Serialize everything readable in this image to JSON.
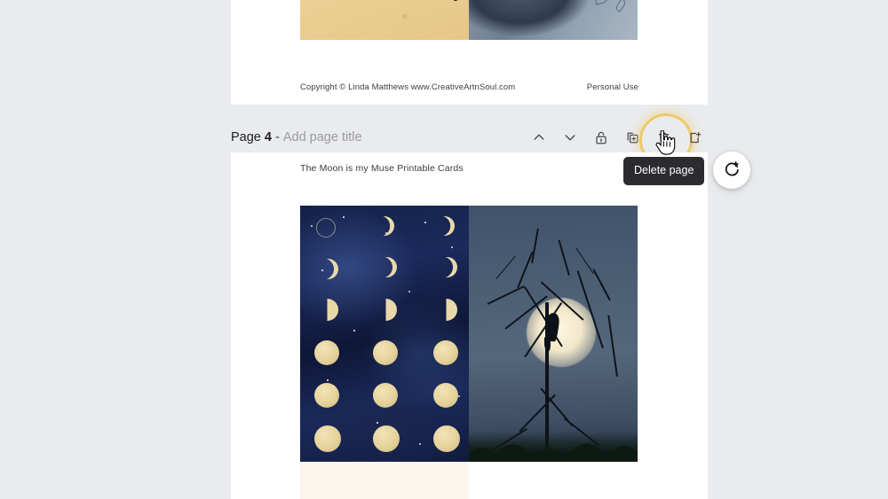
{
  "background_color": "#e9ebee",
  "previous_page": {
    "copyright_text": "Copyright © Linda Matthews www.CreativeArtnSoul.com",
    "license_text": "Personal Use",
    "artwork_left_name": "sand-texture-with-dots",
    "artwork_right_name": "blue-moon-crystal-photo"
  },
  "page_header": {
    "page_label": "Page",
    "page_number": "4",
    "separator": "-",
    "title_placeholder": "Add page title",
    "actions": [
      {
        "name": "move-page-up",
        "icon": "chevron-up-icon",
        "label": "Move page up"
      },
      {
        "name": "move-page-down",
        "icon": "chevron-down-icon",
        "label": "Move page down"
      },
      {
        "name": "lock-page",
        "icon": "unlock-icon",
        "label": "Lock page"
      },
      {
        "name": "duplicate-page",
        "icon": "duplicate-page-icon",
        "label": "Duplicate page"
      },
      {
        "name": "delete-page",
        "icon": "trash-icon",
        "label": "Delete page"
      },
      {
        "name": "add-page",
        "icon": "add-page-icon",
        "label": "Add page"
      }
    ],
    "active_action": "delete-page",
    "highlight_color": "#edbe3c"
  },
  "tooltip": {
    "text": "Delete page",
    "background": "#2b2b30",
    "color": "#ffffff"
  },
  "current_page": {
    "document_heading": "The Moon is my Muse Printable Cards",
    "images": [
      {
        "name": "moon-phases-chart",
        "description": "Moon phases on navy starfield"
      },
      {
        "name": "raven-full-moon",
        "description": "Raven silhouette on bare branches before a full moon"
      },
      {
        "name": "cream-blank-card",
        "description": "Blank cream card"
      },
      {
        "name": "warm-portrait-photo",
        "description": "Warm orange toned photo"
      }
    ]
  },
  "comment_button": {
    "name": "add-comment-button",
    "icon": "comment-plus-icon",
    "label": "Add comment"
  }
}
